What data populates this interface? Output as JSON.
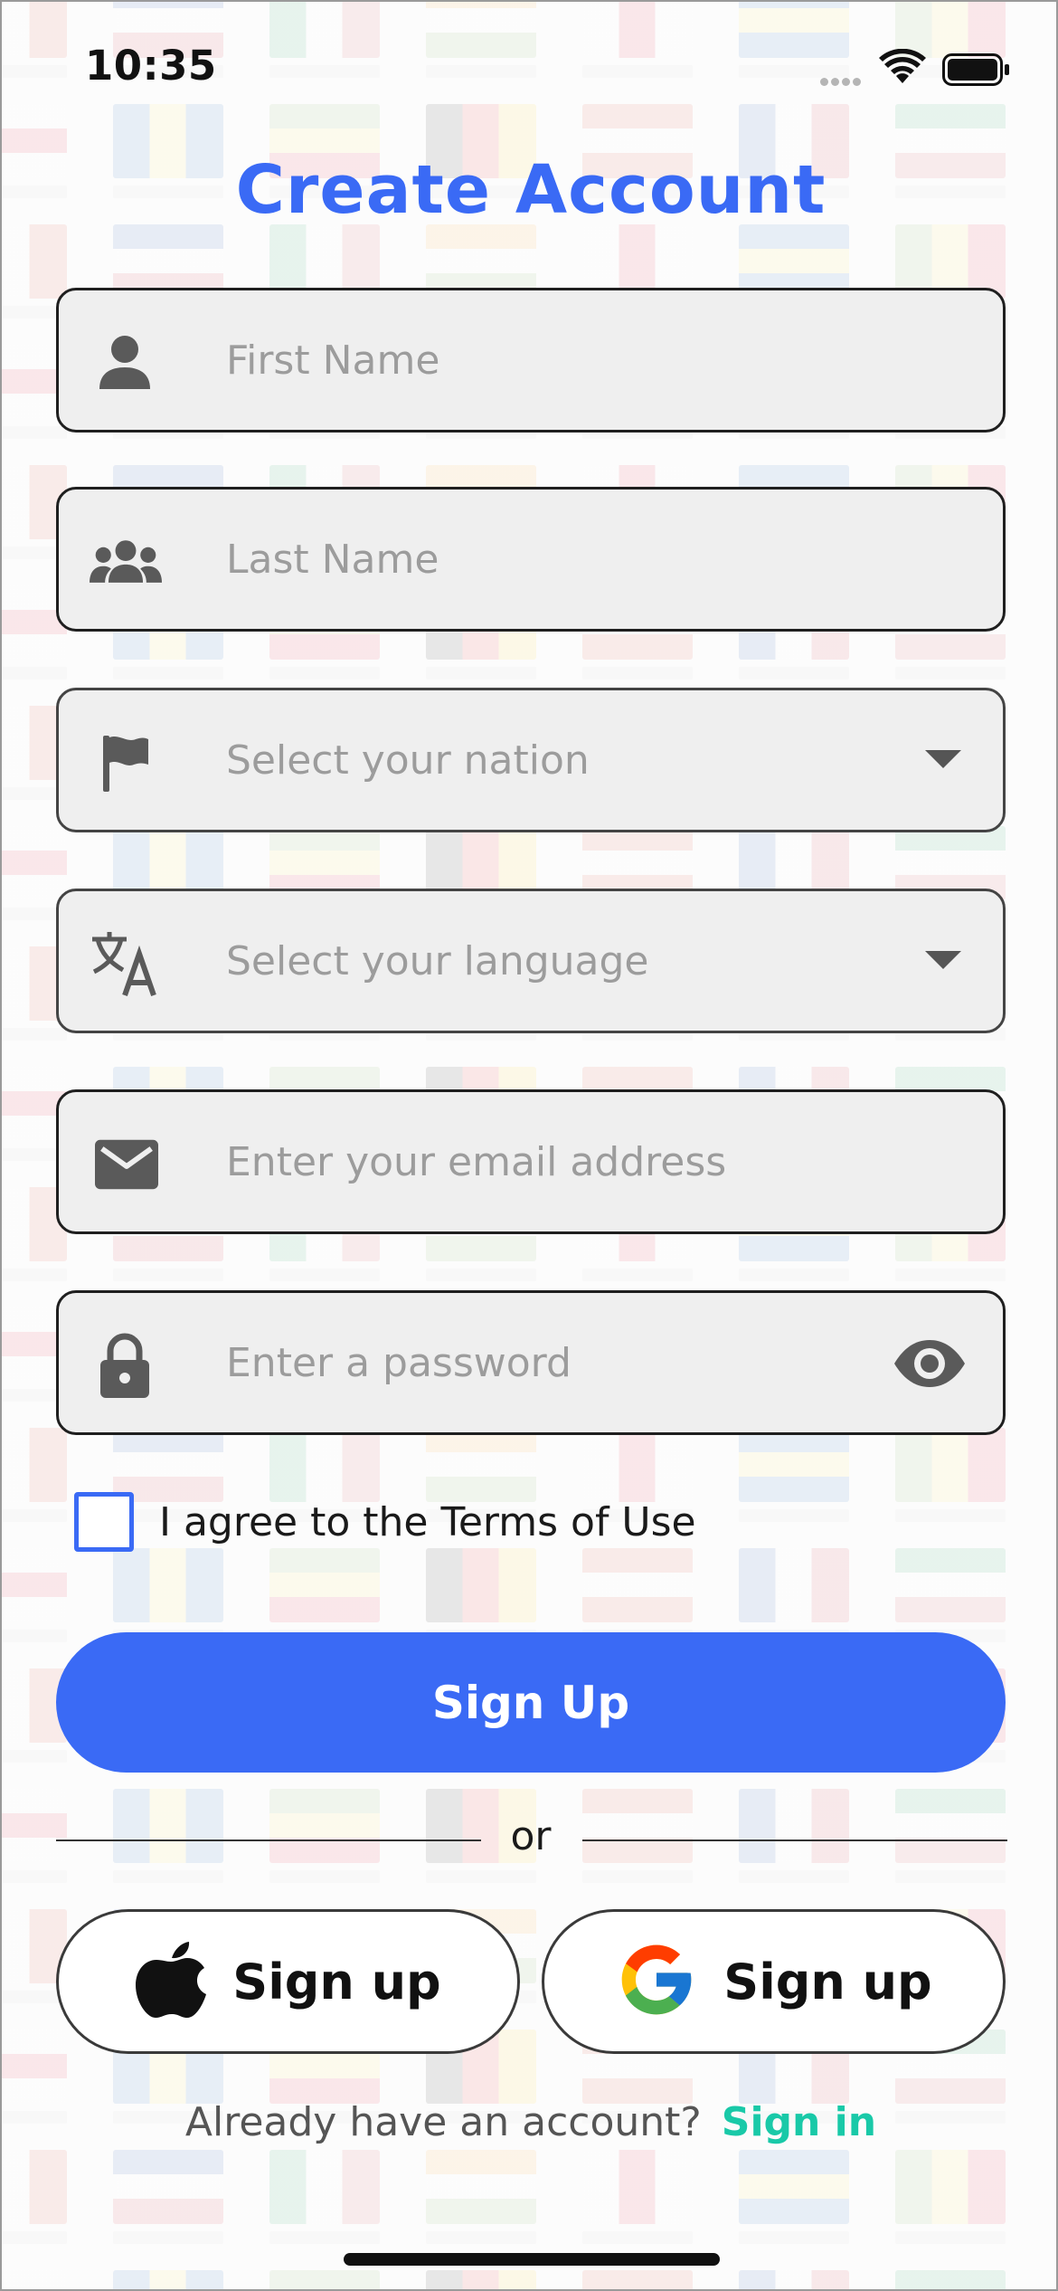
{
  "status_bar": {
    "time": "10:35"
  },
  "header": {
    "title": "Create Account"
  },
  "form": {
    "first_name": {
      "placeholder": "First Name",
      "value": "",
      "icon": "person-icon"
    },
    "last_name": {
      "placeholder": "Last Name",
      "value": "",
      "icon": "group-icon"
    },
    "nation": {
      "placeholder": "Select your nation",
      "icon": "flag-icon"
    },
    "language": {
      "placeholder": "Select your language",
      "icon": "translate-icon"
    },
    "email": {
      "placeholder": "Enter your email address",
      "value": "",
      "icon": "mail-icon"
    },
    "password": {
      "placeholder": "Enter a password",
      "value": "",
      "icon": "lock-icon",
      "toggle_icon": "eye-icon"
    }
  },
  "terms": {
    "label": "I agree to the Terms of Use",
    "checked": false
  },
  "actions": {
    "sign_up_label": "Sign Up",
    "divider_text": "or",
    "apple_label": "Sign up",
    "google_label": "Sign up"
  },
  "footer": {
    "prompt": "Already have an account?",
    "link": "Sign in"
  },
  "colors": {
    "accent": "#3A6AF5",
    "link": "#19C9A8",
    "field_bg": "#EFEFEF",
    "text": "#1A1A1A",
    "placeholder": "#9C9C9C"
  }
}
